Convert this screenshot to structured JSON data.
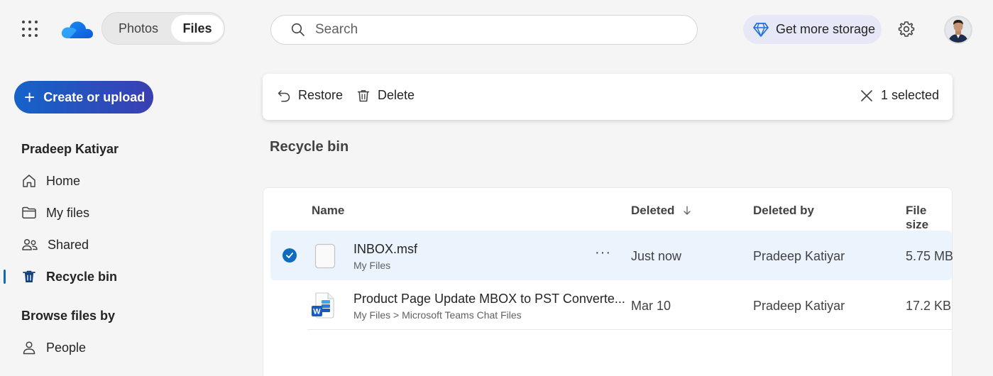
{
  "header": {
    "switcher": {
      "photos_label": "Photos",
      "files_label": "Files",
      "selected": "Files"
    },
    "search": {
      "placeholder": "Search"
    },
    "storage_label": "Get more storage",
    "icons": [
      "app-launcher-icon",
      "onedrive-logo",
      "search-icon",
      "diamond-icon",
      "gear-icon",
      "avatar"
    ]
  },
  "sidebar": {
    "create_label": "Create or upload",
    "user_name": "Pradeep Katiyar",
    "items": [
      {
        "label": "Home",
        "icon": "home-icon"
      },
      {
        "label": "My files",
        "icon": "folder-icon"
      },
      {
        "label": "Shared",
        "icon": "people-icon"
      },
      {
        "label": "Recycle bin",
        "icon": "trash-icon",
        "active": true
      }
    ],
    "browse_heading": "Browse files by",
    "browse_items": [
      {
        "label": "People",
        "icon": "person-icon"
      }
    ]
  },
  "command_bar": {
    "restore_label": "Restore",
    "delete_label": "Delete",
    "selection_label": "1 selected"
  },
  "page_title": "Recycle bin",
  "table": {
    "columns": {
      "name": "Name",
      "deleted": "Deleted",
      "deleted_by": "Deleted by",
      "file_size": "File size"
    },
    "sort": {
      "column": "Deleted",
      "direction": "descending"
    },
    "rows": [
      {
        "name": "INBOX.msf",
        "path": "My Files",
        "deleted": "Just now",
        "deleted_by": "Pradeep Katiyar",
        "size": "5.75 MB",
        "selected": true,
        "icon": "generic-file-icon"
      },
      {
        "name": "Product Page Update MBOX to PST Converte...",
        "path": "My Files > Microsoft Teams Chat Files",
        "deleted": "Mar 10",
        "deleted_by": "Pradeep Katiyar",
        "size": "17.2 KB",
        "selected": false,
        "icon": "word-file-icon"
      }
    ]
  },
  "colors": {
    "accent": "#0f6cbd",
    "selected_row": "#ebf3fc",
    "storage_pill": "#e6e8f8"
  }
}
